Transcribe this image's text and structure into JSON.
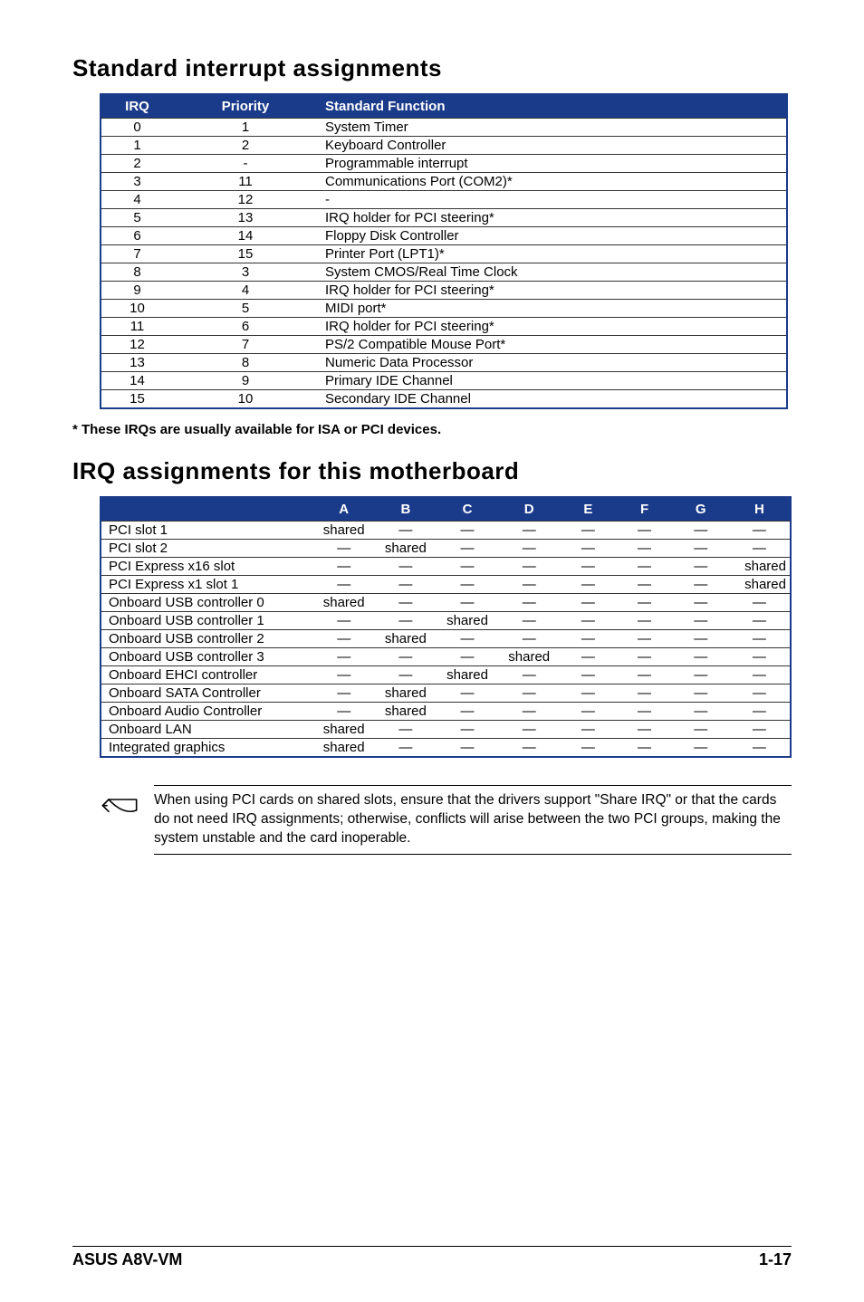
{
  "heading1": "Standard interrupt assignments",
  "table1": {
    "headers": {
      "irq": "IRQ",
      "priority": "Priority",
      "func": "Standard Function"
    },
    "rows": [
      {
        "irq": "0",
        "priority": "1",
        "func": "System Timer"
      },
      {
        "irq": "1",
        "priority": "2",
        "func": "Keyboard Controller"
      },
      {
        "irq": "2",
        "priority": "-",
        "func": "Programmable interrupt"
      },
      {
        "irq": "3",
        "priority": "11",
        "func": "Communications Port (COM2)*"
      },
      {
        "irq": "4",
        "priority": "12",
        "func": "-"
      },
      {
        "irq": "5",
        "priority": "13",
        "func": "IRQ holder for PCI steering*"
      },
      {
        "irq": "6",
        "priority": "14",
        "func": "Floppy Disk Controller"
      },
      {
        "irq": "7",
        "priority": "15",
        "func": "Printer Port (LPT1)*"
      },
      {
        "irq": "8",
        "priority": "3",
        "func": "System CMOS/Real Time Clock"
      },
      {
        "irq": "9",
        "priority": "4",
        "func": "IRQ holder for PCI steering*"
      },
      {
        "irq": "10",
        "priority": "5",
        "func": "MIDI port*"
      },
      {
        "irq": "11",
        "priority": "6",
        "func": "IRQ holder for PCI steering*"
      },
      {
        "irq": "12",
        "priority": "7",
        "func": "PS/2 Compatible Mouse Port*"
      },
      {
        "irq": "13",
        "priority": "8",
        "func": "Numeric Data Processor"
      },
      {
        "irq": "14",
        "priority": "9",
        "func": "Primary IDE Channel"
      },
      {
        "irq": "15",
        "priority": "10",
        "func": "Secondary IDE Channel"
      }
    ]
  },
  "footnote": "* These IRQs are usually available for ISA or PCI devices.",
  "heading2": "IRQ assignments for this motherboard",
  "table2": {
    "headers": {
      "name": "",
      "A": "A",
      "B": "B",
      "C": "C",
      "D": "D",
      "E": "E",
      "F": "F",
      "G": "G",
      "H": "H"
    },
    "dash": "—",
    "shared": "shared",
    "rows": [
      {
        "name": "PCI slot 1",
        "cells": [
          "shared",
          "—",
          "—",
          "—",
          "—",
          "—",
          "—",
          "—"
        ]
      },
      {
        "name": "PCI slot 2",
        "cells": [
          "—",
          "shared",
          "—",
          "—",
          "—",
          "—",
          "—",
          "—"
        ]
      },
      {
        "name": "PCI Express x16 slot",
        "cells": [
          "—",
          "—",
          "—",
          "—",
          "—",
          "—",
          "—",
          "shared"
        ]
      },
      {
        "name": "PCI Express x1 slot 1",
        "cells": [
          "—",
          "—",
          "—",
          "—",
          "—",
          "—",
          "—",
          "shared"
        ]
      },
      {
        "name": "Onboard USB controller 0",
        "cells": [
          "shared",
          "—",
          "—",
          "—",
          "—",
          "—",
          "—",
          "—"
        ]
      },
      {
        "name": "Onboard USB controller 1",
        "cells": [
          "—",
          "—",
          "shared",
          "—",
          "—",
          "—",
          "—",
          "—"
        ]
      },
      {
        "name": "Onboard USB controller 2",
        "cells": [
          "—",
          "shared",
          "—",
          "—",
          "—",
          "—",
          "—",
          "—"
        ]
      },
      {
        "name": "Onboard USB controller 3",
        "cells": [
          "—",
          "—",
          "—",
          "shared",
          "—",
          "—",
          "—",
          "—"
        ]
      },
      {
        "name": "Onboard EHCI controller",
        "cells": [
          "—",
          "—",
          "shared",
          "—",
          "—",
          "—",
          "—",
          "—"
        ]
      },
      {
        "name": "Onboard SATA Controller",
        "cells": [
          "—",
          "shared",
          "—",
          "—",
          "—",
          "—",
          "—",
          "—"
        ]
      },
      {
        "name": "Onboard Audio Controller",
        "cells": [
          "—",
          "shared",
          "—",
          "—",
          "—",
          "—",
          "—",
          "—"
        ]
      },
      {
        "name": "Onboard LAN",
        "cells": [
          "shared",
          "—",
          "—",
          "—",
          "—",
          "—",
          "—",
          "—"
        ]
      },
      {
        "name": "Integrated graphics",
        "cells": [
          "shared",
          "—",
          "—",
          "—",
          "—",
          "—",
          "—",
          "—"
        ]
      }
    ]
  },
  "note_text": "When using PCI cards on shared slots, ensure that the drivers support \"Share IRQ\" or that the cards do not need IRQ assignments; otherwise, conflicts will arise between the two PCI groups, making the system unstable and the card inoperable.",
  "footer": {
    "left": "ASUS A8V-VM",
    "right": "1-17"
  }
}
